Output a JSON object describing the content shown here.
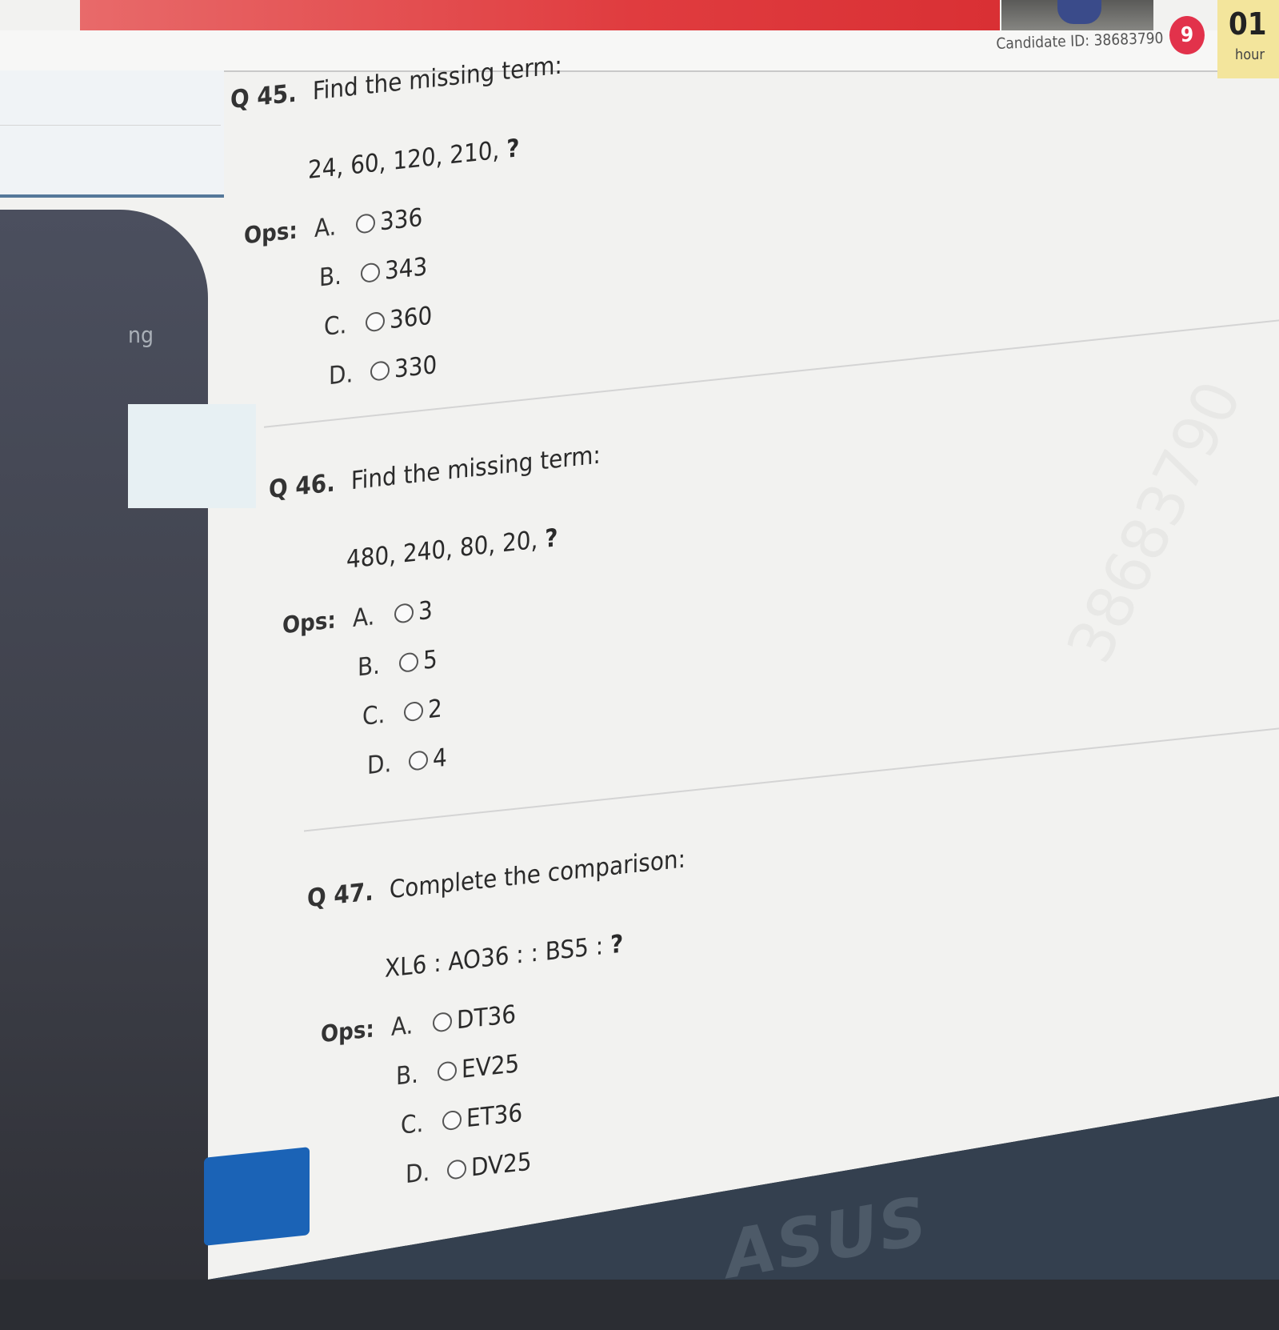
{
  "header": {
    "candidate_id": "Candidate ID: 38683790",
    "question_badge": "9",
    "timer_value": "01",
    "timer_unit": "hour"
  },
  "sidebar": {
    "partial_label": "ng"
  },
  "questions": [
    {
      "number": "Q 45.",
      "prompt": "Find the missing term:",
      "sequence": "24, 60, 120, 210,",
      "mark": "?",
      "ops_label": "Ops:",
      "options": [
        {
          "letter": "A.",
          "value": "336"
        },
        {
          "letter": "B.",
          "value": "343"
        },
        {
          "letter": "C.",
          "value": "360"
        },
        {
          "letter": "D.",
          "value": "330"
        }
      ]
    },
    {
      "number": "Q 46.",
      "prompt": "Find the missing term:",
      "sequence": "480, 240, 80, 20,",
      "mark": "?",
      "ops_label": "Ops:",
      "options": [
        {
          "letter": "A.",
          "value": "3"
        },
        {
          "letter": "B.",
          "value": "5"
        },
        {
          "letter": "C.",
          "value": "2"
        },
        {
          "letter": "D.",
          "value": "4"
        }
      ]
    },
    {
      "number": "Q 47.",
      "prompt": "Complete the comparison:",
      "sequence": "XL6 : AO36 : : BS5 :",
      "mark": "?",
      "ops_label": "Ops:",
      "options": [
        {
          "letter": "A.",
          "value": "DT36"
        },
        {
          "letter": "B.",
          "value": "EV25"
        },
        {
          "letter": "C.",
          "value": "ET36"
        },
        {
          "letter": "D.",
          "value": "DV25"
        }
      ]
    }
  ],
  "laptop_logo": "ASUS"
}
